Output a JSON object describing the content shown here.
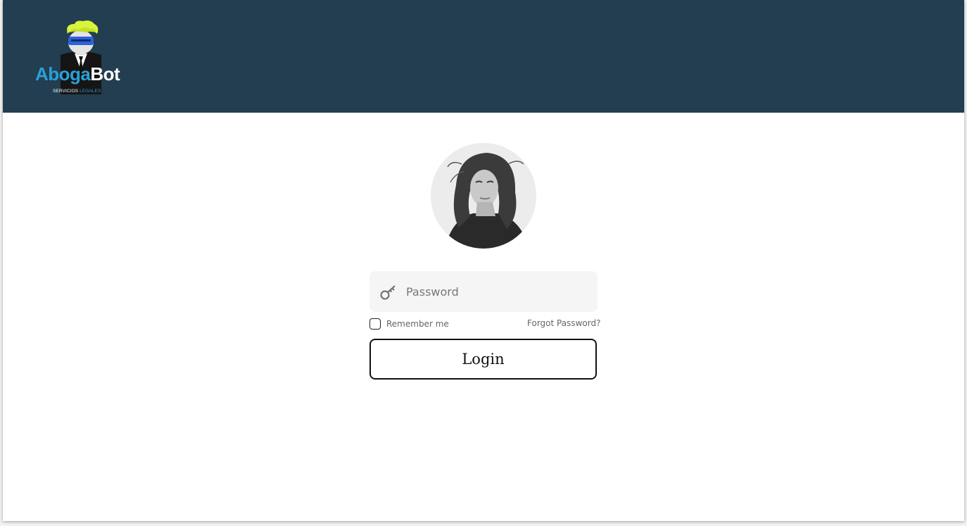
{
  "header": {
    "logo": {
      "name_part1": "Aboga",
      "name_part2": "Bot",
      "tagline_part1": "SERVICIOS ",
      "tagline_part2": "LEGALES",
      "accent_color": "#2a9fd8",
      "hair_color": "#d9f53a",
      "visor_color": "#2b62d9"
    },
    "background_color": "#223e50"
  },
  "login": {
    "avatar_alt": "profile photo",
    "password_placeholder": "Password",
    "password_value": "",
    "remember_label": "Remember me",
    "remember_checked": false,
    "forgot_label": "Forgot Password?",
    "login_label": "Login"
  },
  "icons": {
    "password_field": "key-icon"
  }
}
